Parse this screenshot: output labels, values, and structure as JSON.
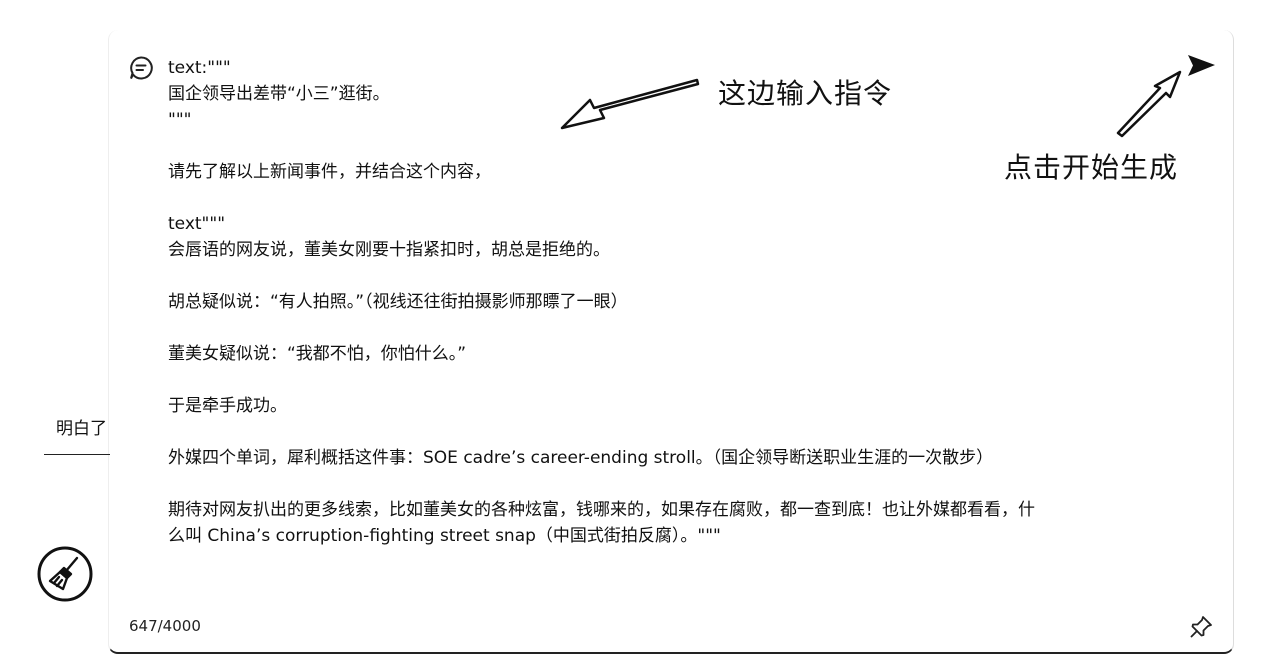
{
  "prompt": {
    "text": "text:\"\"\"\n国企领导出差带“小三”逛街。\n\"\"\"\n\n请先了解以上新闻事件，并结合这个内容，\n\ntext\"\"\"\n会唇语的网友说，董美女刚要十指紧扣时，胡总是拒绝的。\n\n胡总疑似说：“有人拍照。”（视线还往街拍摄影师那瞟了一眼）\n\n董美女疑似说：“我都不怕，你怕什么。”\n\n于是牵手成功。\n\n外媒四个单词，犀利概括这件事：SOE cadre’s career-ending stroll。（国企领导断送职业生涯的一次散步）\n\n期待对网友扒出的更多线索，比如董美女的各种炫富，钱哪来的，如果存在腐败，都一查到底！也让外媒都看看，什\n么叫 China’s corruption-fighting street snap（中国式街拍反腐）。\"\"\""
  },
  "char_count": "647/4000",
  "annotations": {
    "input_hint": "这边输入指令",
    "start_hint": "点击开始生成"
  },
  "reply_chip": {
    "label": "明白了"
  },
  "icons": {
    "prompt": "chat-bubble-icon",
    "send": "send-icon",
    "pin": "pin-icon",
    "clean": "broom-icon"
  }
}
